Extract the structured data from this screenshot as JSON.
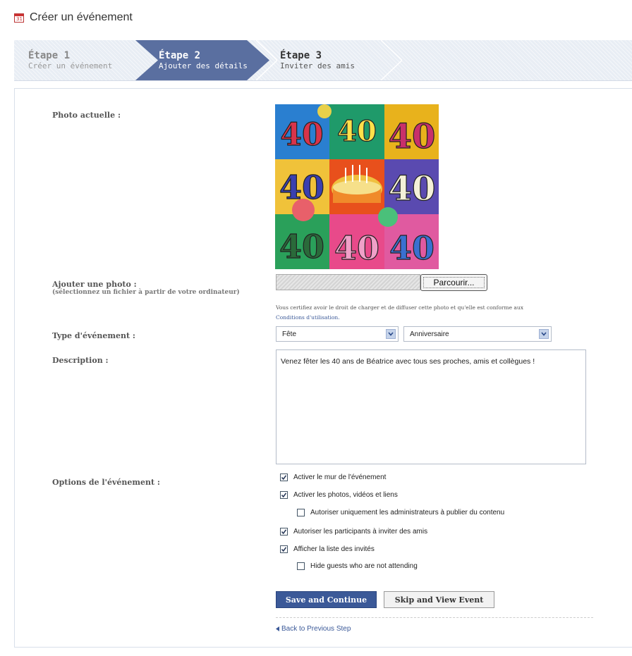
{
  "page": {
    "title": "Créer un événement",
    "title_icon": "calendar-icon",
    "calendar_icon_text": "31"
  },
  "steps": [
    {
      "title": "Étape 1",
      "subtitle": "Créer un événement",
      "state": "done"
    },
    {
      "title": "Étape 2",
      "subtitle": "Ajouter des détails",
      "state": "active"
    },
    {
      "title": "Étape 3",
      "subtitle": "Inviter des amis",
      "state": "upcoming"
    }
  ],
  "form": {
    "current_photo_label": "Photo actuelle :",
    "add_photo_label": "Ajouter une photo :",
    "add_photo_hint": "(sélectionnez un fichier à partir de votre ordinateur)",
    "file_value": "",
    "browse_label": "Parcourir...",
    "certify_text": "Vous certifiez avoir le droit de charger et de diffuser cette photo et qu'elle est conforme aux",
    "terms_link": "Conditions d'utilisation.",
    "event_type_label": "Type d'événement :",
    "event_type_value": "Fête",
    "event_subtype_value": "Anniversaire",
    "description_label": "Description :",
    "description_value": "Venez fêter les 40 ans de Béatrice avec tous ses proches, amis et collègues !",
    "options_label": "Options de l'événement :",
    "options": [
      {
        "label": "Activer le mur de l'événement",
        "checked": true,
        "indent": false
      },
      {
        "label": "Activer les photos, vidéos et liens",
        "checked": true,
        "indent": false
      },
      {
        "label": "Autoriser uniquement les administrateurs à publier du contenu",
        "checked": false,
        "indent": true
      },
      {
        "label": "Autoriser les participants à inviter des amis",
        "checked": true,
        "indent": false
      },
      {
        "label": "Afficher la liste des invités",
        "checked": true,
        "indent": false
      },
      {
        "label": "Hide guests who are not attending",
        "checked": false,
        "indent": true
      }
    ]
  },
  "photo": {
    "numbers": [
      "40",
      "40",
      "40",
      "40",
      "40",
      "40",
      "40",
      "40"
    ]
  },
  "actions": {
    "save_label": "Save and Continue",
    "skip_label": "Skip and View Event",
    "back_label": "Back to Previous Step"
  },
  "colors": {
    "brand": "#3b5998",
    "active_step": "#5a6fa0",
    "border": "#b4bcc9"
  }
}
